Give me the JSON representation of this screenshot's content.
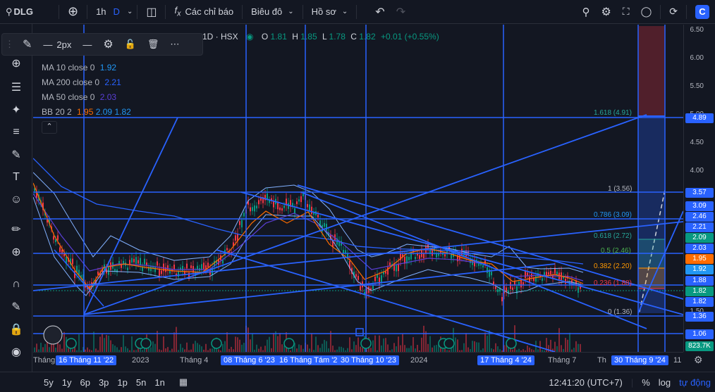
{
  "topbar": {
    "symbol": "DLG",
    "interval": "1h",
    "interval_d": "D",
    "indicators_label": "Các chỉ báo",
    "chart_type_label": "Biêu đô",
    "profile_label": "Hồ sơ"
  },
  "legend": {
    "title": "1D · HSX",
    "o_label": "O",
    "o": "1.81",
    "h_label": "H",
    "h": "1.85",
    "l_label": "L",
    "l": "1.78",
    "c_label": "C",
    "c": "1.82",
    "change": "+0.01 (+0.55%)",
    "ma10": "MA 10 close 0",
    "ma10_val": "1.92",
    "ma200": "MA 200 close 0",
    "ma200_val": "2.21",
    "ma50": "MA 50 close 0",
    "ma50_val": "2.03",
    "bb": "BB 20 2",
    "bb_v1": "1.95",
    "bb_v2": "2.09",
    "bb_v3": "1.82"
  },
  "float_toolbar": {
    "width_label": "2px"
  },
  "fib_levels": [
    {
      "label": "1.618 (4.91)",
      "color": "#26a69a"
    },
    {
      "label": "1 (3.56)",
      "color": "#b2b5be"
    },
    {
      "label": "0.786 (3.09)",
      "color": "#2196f3"
    },
    {
      "label": "0.618 (2.72)",
      "color": "#26a69a"
    },
    {
      "label": "0.5 (2.46)",
      "color": "#4caf50"
    },
    {
      "label": "0.382 (2.20)",
      "color": "#ff9800"
    },
    {
      "label": "0.236 (1.88)",
      "color": "#f23645"
    },
    {
      "label": "0 (1.36)",
      "color": "#b2b5be"
    }
  ],
  "price_ticks": [
    "6.50",
    "6.00",
    "5.50",
    "5.00",
    "4.50",
    "4.00",
    "1.50"
  ],
  "price_badges": [
    {
      "text": "4.89",
      "color": "#2962ff"
    },
    {
      "text": "3.57",
      "color": "#2962ff"
    },
    {
      "text": "3.09",
      "color": "#2962ff"
    },
    {
      "text": "2.46",
      "color": "#2962ff"
    },
    {
      "text": "2.21",
      "color": "#2962ff"
    },
    {
      "text": "2.09",
      "color": "#089981"
    },
    {
      "text": "2.03",
      "color": "#2962ff"
    },
    {
      "text": "1.95",
      "color": "#ff6d00"
    },
    {
      "text": "1.92",
      "color": "#2196f3"
    },
    {
      "text": "1.88",
      "color": "#2962ff"
    },
    {
      "text": "1.82",
      "color": "#089981"
    },
    {
      "text": "1.82",
      "color": "#2962ff"
    },
    {
      "text": "1.36",
      "color": "#2962ff"
    },
    {
      "text": "1.06",
      "color": "#2962ff"
    },
    {
      "text": "823.7K",
      "color": "#089981"
    }
  ],
  "time_labels": [
    "Tháng",
    "2023",
    "Tháng 4",
    "2024",
    "Tháng 7",
    "Th",
    "11"
  ],
  "time_badges": [
    "16 Tháng 11 '22",
    "08 Tháng 6 '23",
    "16 Tháng Tám '23",
    "30 Tháng 10 '23",
    "17 Tháng 4 '24",
    "30 Tháng 9 '24"
  ],
  "bottombar": {
    "ranges": [
      "5y",
      "1y",
      "6p",
      "3p",
      "1p",
      "5n",
      "1n"
    ],
    "clock": "12:41:20 (UTC+7)",
    "pct": "%",
    "log": "log",
    "auto": "tự động"
  },
  "colors": {
    "accent": "#2962ff",
    "up": "#089981",
    "down": "#f23645",
    "bg": "#131722"
  }
}
